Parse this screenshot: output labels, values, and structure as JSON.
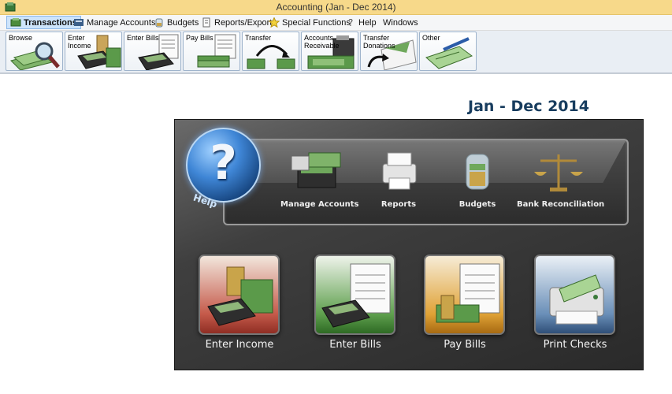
{
  "window": {
    "title": "Accounting (Jan - Dec 2014)"
  },
  "menu": {
    "items": [
      {
        "label": "Transactions",
        "icon": "transactions-icon"
      },
      {
        "label": "Manage Accounts",
        "icon": "accounts-icon"
      },
      {
        "label": "Budgets",
        "icon": "budget-jar-icon"
      },
      {
        "label": "Reports/Export",
        "icon": "report-icon"
      },
      {
        "label": "Special Functions",
        "icon": "star-icon"
      },
      {
        "label": "Help",
        "icon": "help-icon"
      },
      {
        "label": "Windows",
        "icon": ""
      }
    ]
  },
  "toolbar": {
    "buttons": [
      {
        "label": "Browse",
        "icon": "magnifier-money-icon"
      },
      {
        "label": "Enter Income",
        "icon": "calculator-coins-icon"
      },
      {
        "label": "Enter Bills",
        "icon": "bill-calculator-icon"
      },
      {
        "label": "Pay Bills",
        "icon": "bill-money-icon"
      },
      {
        "label": "Transfer",
        "icon": "transfer-arrow-icon"
      },
      {
        "label": "Accounts Receivable",
        "icon": "register-money-icon"
      },
      {
        "label": "Transfer Donations",
        "icon": "envelope-arrow-icon"
      },
      {
        "label": "Other",
        "icon": "check-pen-icon"
      }
    ]
  },
  "content": {
    "heading": "Jan - Dec 2014",
    "help": {
      "label": "Help"
    },
    "top_items": [
      {
        "label": "Manage Accounts",
        "icon": "accounts-ledger-icon"
      },
      {
        "label": "Reports",
        "icon": "printer-icon"
      },
      {
        "label": "Budgets",
        "icon": "coin-jar-icon"
      },
      {
        "label": "Bank Reconciliation",
        "icon": "scales-icon"
      }
    ],
    "tiles": [
      {
        "label": "Enter Income",
        "icon": "calculator-coins-icon"
      },
      {
        "label": "Enter Bills",
        "icon": "bill-calculator-icon"
      },
      {
        "label": "Pay Bills",
        "icon": "bill-coins-icon"
      },
      {
        "label": "Print Checks",
        "icon": "check-printer-icon"
      }
    ]
  },
  "colors": {
    "titlebar": "#f7d98a",
    "heading": "#173c5e",
    "panel": "#3f3f3f"
  }
}
